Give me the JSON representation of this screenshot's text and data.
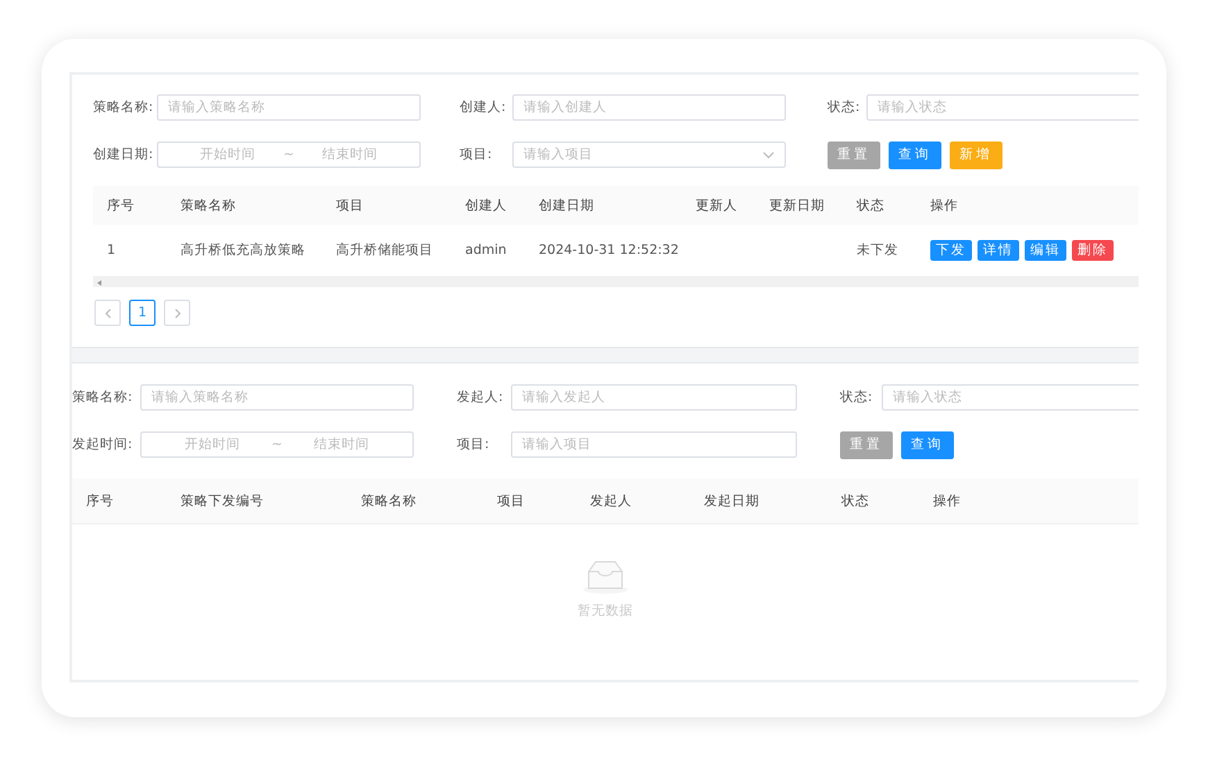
{
  "strategy_list": {
    "filters": [
      {
        "kind": "text",
        "label": "策略名称:",
        "placeholder": "请输入策略名称"
      },
      {
        "kind": "text",
        "label": "创建人:",
        "placeholder": "请输入创建人"
      },
      {
        "kind": "text",
        "label": "状态:",
        "placeholder": "请输入状态"
      },
      {
        "kind": "range",
        "label": "创建日期:",
        "placeholder_start": "开始时间",
        "separator": "~",
        "placeholder_end": "结束时间"
      },
      {
        "kind": "select",
        "label": "项目:",
        "placeholder": "请输入项目"
      }
    ],
    "buttons": [
      {
        "kind": "reset",
        "label": "重置"
      },
      {
        "kind": "search",
        "label": "查询"
      },
      {
        "kind": "add",
        "label": "新增"
      }
    ],
    "table": {
      "columns": [
        "序号",
        "策略名称",
        "项目",
        "创建人",
        "创建日期",
        "更新人",
        "更新日期",
        "状态",
        "操作"
      ],
      "rows": [
        {
          "cells": [
            "1",
            "高升桥低充高放策略",
            "高升桥储能项目",
            "admin",
            "2024-10-31 12:52:32",
            "",
            "",
            "未下发"
          ],
          "actions": [
            {
              "kind": "primary",
              "label": "下发"
            },
            {
              "kind": "primary",
              "label": "详情"
            },
            {
              "kind": "primary",
              "label": "编辑"
            },
            {
              "kind": "danger",
              "label": "删除"
            }
          ]
        }
      ]
    },
    "pagination": {
      "pages": [
        {
          "label": "1",
          "selected": true
        }
      ]
    }
  },
  "dispatch_list": {
    "filters": [
      {
        "kind": "text",
        "label": "策略名称:",
        "placeholder": "请输入策略名称"
      },
      {
        "kind": "text",
        "label": "发起人:",
        "placeholder": "请输入发起人"
      },
      {
        "kind": "text",
        "label": "状态:",
        "placeholder": "请输入状态"
      },
      {
        "kind": "range",
        "label": "发起时间:",
        "placeholder_start": "开始时间",
        "separator": "~",
        "placeholder_end": "结束时间"
      },
      {
        "kind": "text",
        "label": "项目:",
        "placeholder": "请输入项目"
      }
    ],
    "buttons": [
      {
        "kind": "reset",
        "label": "重置"
      },
      {
        "kind": "search",
        "label": "查询"
      }
    ],
    "table": {
      "columns": [
        "序号",
        "策略下发编号",
        "策略名称",
        "项目",
        "发起人",
        "发起日期",
        "状态",
        "操作"
      ]
    },
    "empty_text": "暂无数据"
  }
}
